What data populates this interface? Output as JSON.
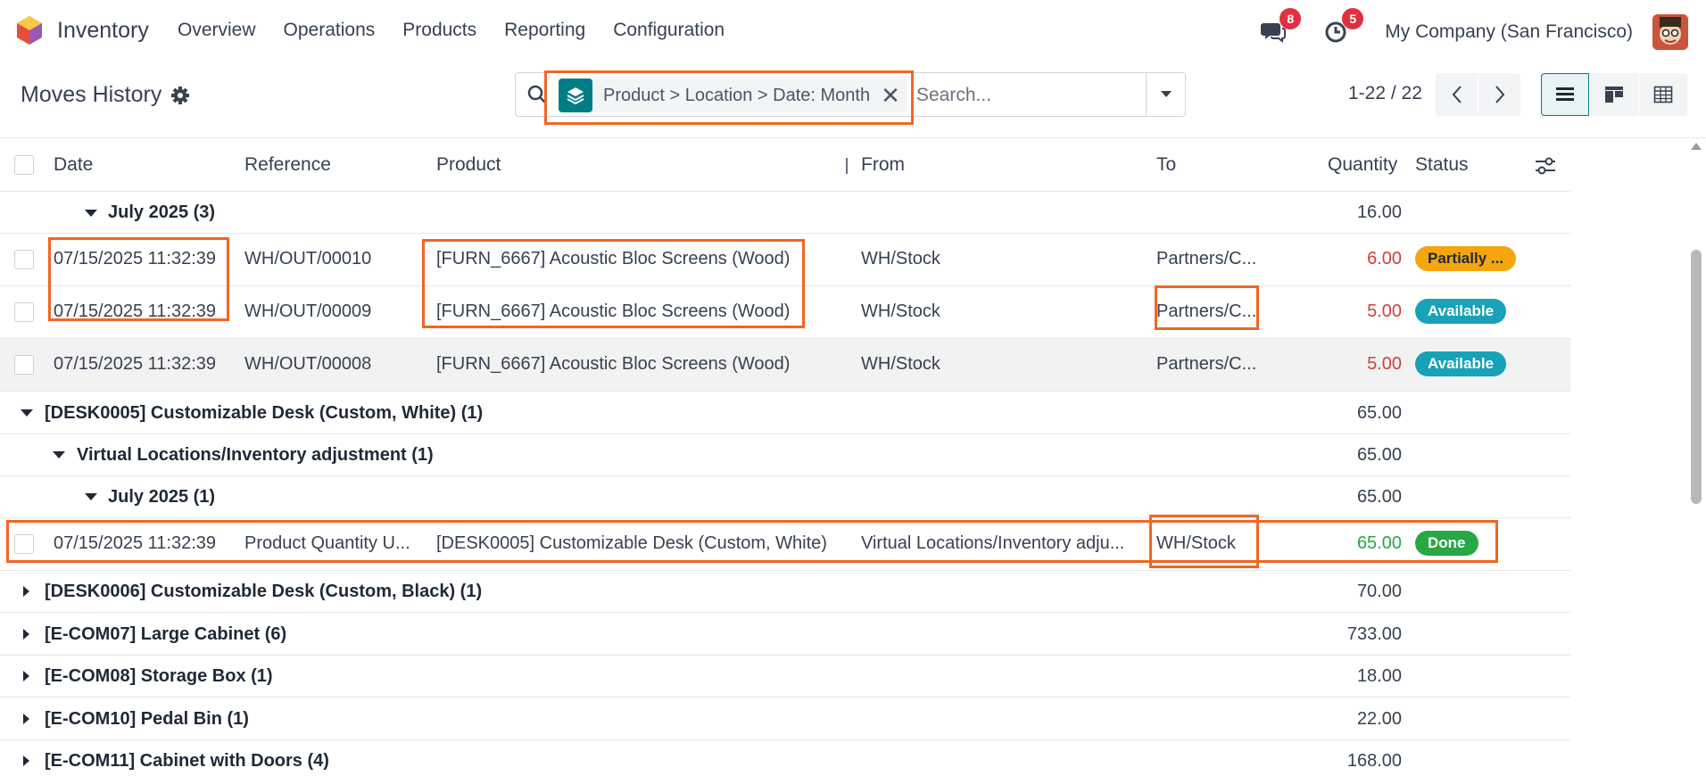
{
  "app": {
    "name": "Inventory",
    "menu": [
      "Overview",
      "Operations",
      "Products",
      "Reporting",
      "Configuration"
    ],
    "messages_badge": "8",
    "activities_badge": "5",
    "company": "My Company (San Francisco)"
  },
  "control": {
    "title": "Moves History",
    "facet": "Product > Location > Date: Month",
    "search_placeholder": "Search...",
    "pager": "1-22 / 22"
  },
  "columns": {
    "date": "Date",
    "reference": "Reference",
    "product": "Product",
    "from": "From",
    "to": "To",
    "quantity": "Quantity",
    "status": "Status"
  },
  "rows": [
    {
      "kind": "group",
      "level": 2,
      "label": "July 2025 (3)",
      "qty": "16.00",
      "expanded": true
    },
    {
      "kind": "record",
      "date": "07/15/2025 11:32:39",
      "reference": "WH/OUT/00010",
      "product": "[FURN_6667] Acoustic Bloc Screens (Wood)",
      "from": "WH/Stock",
      "to": "Partners/C...",
      "qty": "6.00",
      "qty_color": "red",
      "status": "Partially ...",
      "status_type": "partial"
    },
    {
      "kind": "record",
      "date": "07/15/2025 11:32:39",
      "reference": "WH/OUT/00009",
      "product": "[FURN_6667] Acoustic Bloc Screens (Wood)",
      "from": "WH/Stock",
      "to": "Partners/C...",
      "qty": "5.00",
      "qty_color": "red",
      "status": "Available",
      "status_type": "available"
    },
    {
      "kind": "record",
      "date": "07/15/2025 11:32:39",
      "reference": "WH/OUT/00008",
      "product": "[FURN_6667] Acoustic Bloc Screens (Wood)",
      "from": "WH/Stock",
      "to": "Partners/C...",
      "qty": "5.00",
      "qty_color": "red",
      "status": "Available",
      "status_type": "available",
      "hover": true
    },
    {
      "kind": "group",
      "level": 0,
      "label": "[DESK0005] Customizable Desk (Custom, White) (1)",
      "qty": "65.00",
      "expanded": true
    },
    {
      "kind": "group",
      "level": 1,
      "label": "Virtual Locations/Inventory adjustment (1)",
      "qty": "65.00",
      "expanded": true
    },
    {
      "kind": "group",
      "level": 2,
      "label": "July 2025 (1)",
      "qty": "65.00",
      "expanded": true
    },
    {
      "kind": "record",
      "date": "07/15/2025 11:32:39",
      "reference": "Product Quantity U...",
      "product": "[DESK0005] Customizable Desk (Custom, White)",
      "from": "Virtual Locations/Inventory adju...",
      "to": "WH/Stock",
      "qty": "65.00",
      "qty_color": "green",
      "status": "Done",
      "status_type": "done"
    },
    {
      "kind": "group",
      "level": 0,
      "label": "[DESK0006] Customizable Desk (Custom, Black) (1)",
      "qty": "70.00",
      "expanded": false
    },
    {
      "kind": "group",
      "level": 0,
      "label": "[E-COM07] Large Cabinet (6)",
      "qty": "733.00",
      "expanded": false
    },
    {
      "kind": "group",
      "level": 0,
      "label": "[E-COM08] Storage Box (1)",
      "qty": "18.00",
      "expanded": false
    },
    {
      "kind": "group",
      "level": 0,
      "label": "[E-COM10] Pedal Bin (1)",
      "qty": "22.00",
      "expanded": false
    },
    {
      "kind": "group",
      "level": 0,
      "label": "[E-COM11] Cabinet with Doors (4)",
      "qty": "168.00",
      "expanded": false
    }
  ],
  "colors": {
    "accent": "#017e84",
    "annotation": "#f26522",
    "badge": "#e0303f"
  }
}
